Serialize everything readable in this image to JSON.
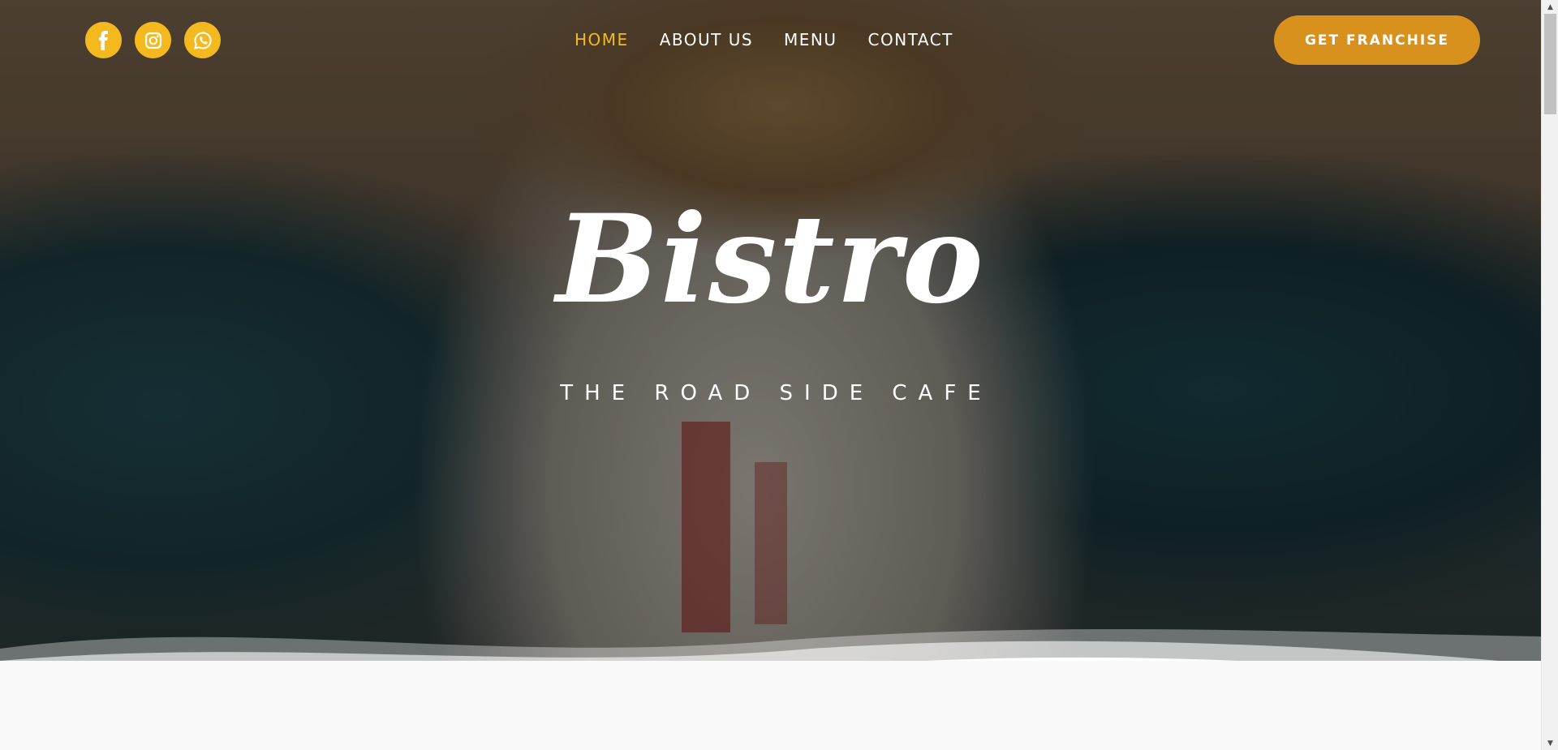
{
  "social": [
    {
      "name": "facebook-icon"
    },
    {
      "name": "instagram-icon"
    },
    {
      "name": "whatsapp-icon"
    }
  ],
  "nav": {
    "items": [
      {
        "label": "HOME",
        "active": true
      },
      {
        "label": "ABOUT US",
        "active": false
      },
      {
        "label": "MENU",
        "active": false
      },
      {
        "label": "CONTACT",
        "active": false
      }
    ]
  },
  "cta": {
    "label": "GET FRANCHISE"
  },
  "hero": {
    "title": "Bistro",
    "subtitle": "THE ROAD SIDE CAFE"
  },
  "colors": {
    "accent": "#f4b91f",
    "cta": "#d8911d",
    "text": "#ffffff"
  },
  "scrollbar": {
    "up": "▲",
    "down": "▼"
  }
}
